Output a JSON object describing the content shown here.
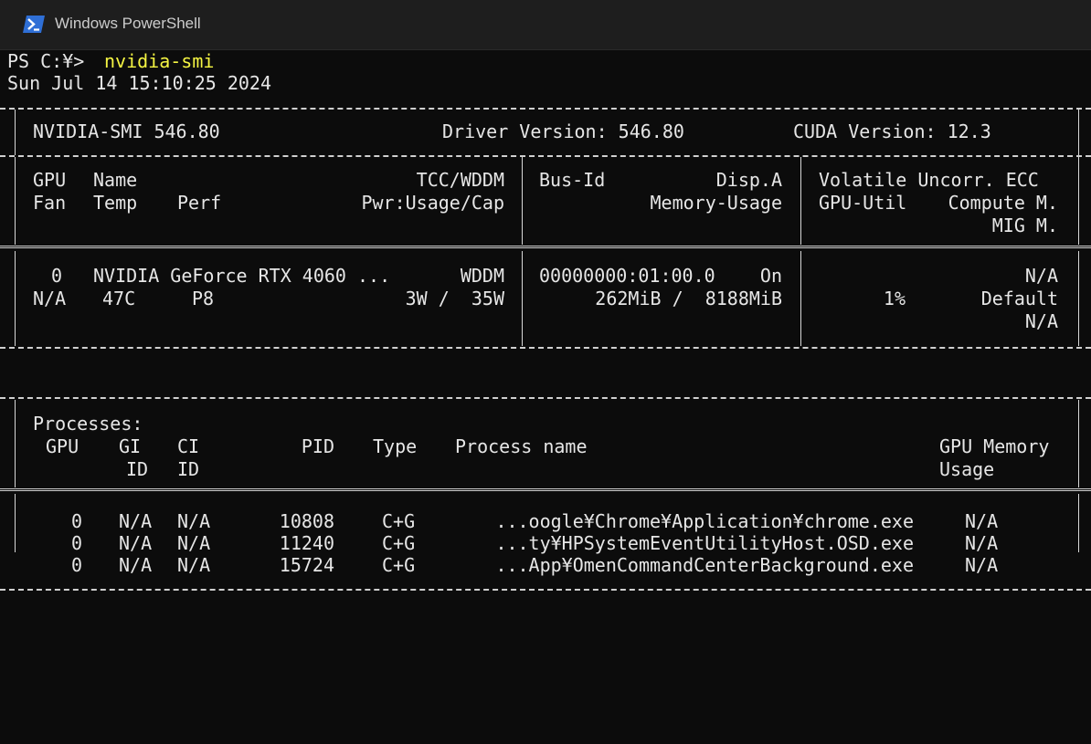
{
  "window": {
    "title": "Windows PowerShell",
    "icon": "powershell-icon"
  },
  "console": {
    "prompt": "PS C:¥>",
    "command": "nvidia-smi",
    "timestamp": "Sun Jul 14 15:10:25 2024"
  },
  "smi": {
    "header": {
      "smi_version": "NVIDIA-SMI 546.80",
      "driver_version": "Driver Version: 546.80",
      "cuda_version": "CUDA Version: 12.3"
    },
    "columns": {
      "gpu": "GPU",
      "name": "Name",
      "tcc": "TCC/WDDM",
      "fan": "Fan",
      "temp": "Temp",
      "perf": "Perf",
      "pwr": "Pwr:Usage/Cap",
      "bus_id": "Bus-Id",
      "disp": "Disp.A",
      "mem_usage": "Memory-Usage",
      "volatile": "Volatile Uncorr. ECC",
      "gpu_util": "GPU-Util",
      "compute": "Compute M.",
      "mig": "MIG M."
    },
    "gpu": {
      "index": "0",
      "name": "NVIDIA GeForce RTX 4060 ...",
      "mode": "WDDM",
      "fan": "N/A",
      "temp": "47C",
      "perf": "P8",
      "power": "3W /  35W",
      "bus_id": "00000000:01:00.0",
      "disp": "On",
      "memory": "262MiB /  8188MiB",
      "ecc": "N/A",
      "util": "1%",
      "compute": "Default",
      "mig": "N/A"
    },
    "processes": {
      "title": "Processes:",
      "columns": {
        "gpu": "GPU",
        "gi": "GI",
        "gi_id": "ID",
        "ci": "CI",
        "ci_id": "ID",
        "pid": "PID",
        "type": "Type",
        "name": "Process name",
        "mem": "GPU Memory",
        "mem_usage": "Usage"
      },
      "rows": [
        {
          "gpu": "0",
          "gi": "N/A",
          "ci": "N/A",
          "pid": "10808",
          "type": "C+G",
          "name": "...oogle¥Chrome¥Application¥chrome.exe",
          "mem": "N/A"
        },
        {
          "gpu": "0",
          "gi": "N/A",
          "ci": "N/A",
          "pid": "11240",
          "type": "C+G",
          "name": "...ty¥HPSystemEventUtilityHost.OSD.exe",
          "mem": "N/A"
        },
        {
          "gpu": "0",
          "gi": "N/A",
          "ci": "N/A",
          "pid": "15724",
          "type": "C+G",
          "name": "...App¥OmenCommandCenterBackground.exe",
          "mem": "N/A"
        }
      ]
    }
  },
  "colors": {
    "background": "#0c0c0c",
    "text": "#e6e6e6",
    "command": "#f5f543",
    "titlebar": "#1e1e1e"
  }
}
